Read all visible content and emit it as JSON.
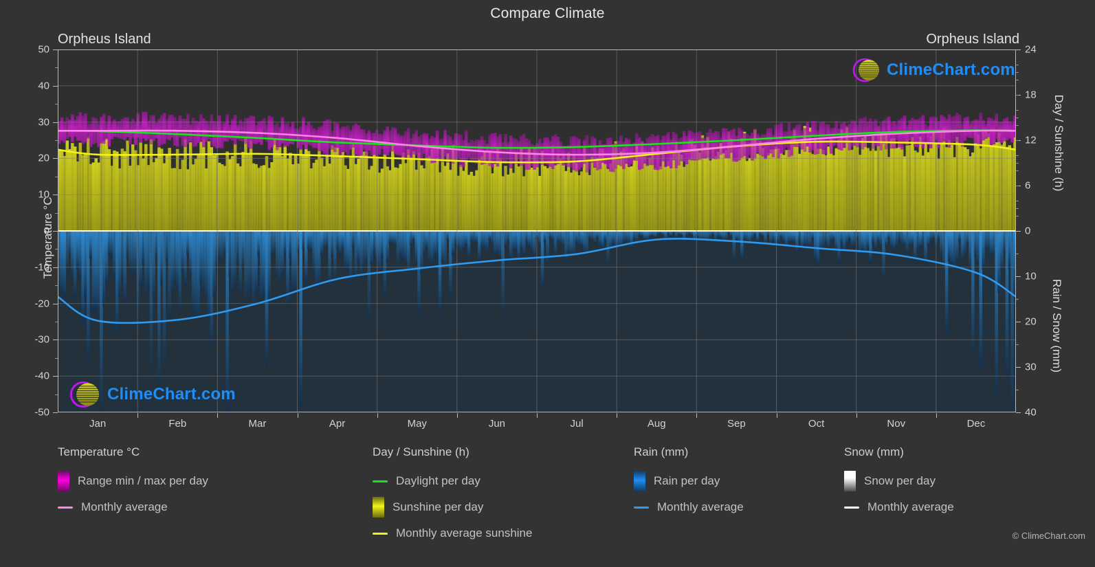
{
  "header": {
    "title": "Compare Climate",
    "location_left": "Orpheus Island",
    "location_right": "Orpheus Island"
  },
  "axes": {
    "left_title": "Temperature °C",
    "right_title_top": "Day / Sunshine (h)",
    "right_title_bottom": "Rain / Snow (mm)",
    "temp_ticks": [
      "50",
      "40",
      "30",
      "20",
      "10",
      "0",
      "-10",
      "-20",
      "-30",
      "-40",
      "-50"
    ],
    "sun_ticks": [
      "24",
      "18",
      "12",
      "6",
      "0"
    ],
    "rain_ticks": [
      "0",
      "10",
      "20",
      "30",
      "40"
    ],
    "months": [
      "Jan",
      "Feb",
      "Mar",
      "Apr",
      "May",
      "Jun",
      "Jul",
      "Aug",
      "Sep",
      "Oct",
      "Nov",
      "Dec"
    ]
  },
  "legend": {
    "groups": [
      {
        "title": "Temperature °C",
        "items": [
          {
            "label": "Range min / max per day",
            "swatch": "gradient",
            "color": "#ff00e6",
            "color2": "#6d0a63"
          },
          {
            "label": "Monthly average",
            "swatch": "line",
            "color": "#ff84e8"
          }
        ]
      },
      {
        "title": "Day / Sunshine (h)",
        "items": [
          {
            "label": "Daylight per day",
            "swatch": "line",
            "color": "#19e619"
          },
          {
            "label": "Sunshine per day",
            "swatch": "gradient",
            "color": "#f2f21a",
            "color2": "#6b6b10"
          },
          {
            "label": "Monthly average sunshine",
            "swatch": "line",
            "color": "#f2f21a"
          }
        ]
      },
      {
        "title": "Rain (mm)",
        "items": [
          {
            "label": "Rain per day",
            "swatch": "gradient",
            "color": "#1f8df5",
            "color2": "#123a60"
          },
          {
            "label": "Monthly average",
            "swatch": "line",
            "color": "#2f9bf0"
          }
        ]
      },
      {
        "title": "Snow (mm)",
        "items": [
          {
            "label": "Snow per day",
            "swatch": "gradient",
            "color": "#ffffff",
            "color2": "#5a5a5a"
          },
          {
            "label": "Monthly average",
            "swatch": "line",
            "color": "#ffffff"
          }
        ]
      }
    ]
  },
  "watermark": {
    "text": "ClimeChart.com",
    "copyright": "© ClimeChart.com"
  },
  "colors": {
    "background": "#333333",
    "plot_background": "#2f2f2f",
    "grid": "#7d7d7d",
    "axis": "#b9b9b9",
    "text": "#d2d2d2",
    "temp_range": "#c016c0",
    "temp_avg": "#ff84e8",
    "daylight": "#19e619",
    "sunshine": "#f2f21a",
    "rain": "#1f8df5",
    "snow": "#ffffff",
    "watermark_text": "#1f8df5",
    "watermark_arc": "#c016f0"
  },
  "chart_data": {
    "type": "line",
    "title": "Compare Climate",
    "subtitle": "Orpheus Island",
    "xlabel": "",
    "ylabel": "Temperature °C",
    "grid": true,
    "legend_position": "bottom",
    "x": [
      "Jan",
      "Feb",
      "Mar",
      "Apr",
      "May",
      "Jun",
      "Jul",
      "Aug",
      "Sep",
      "Oct",
      "Nov",
      "Dec"
    ],
    "temperature_ylim": [
      -50,
      50
    ],
    "sunshine_ylim": [
      0,
      24
    ],
    "rain_ylim": [
      0,
      40
    ],
    "series": [
      {
        "name": "Monthly average",
        "unit": "°C",
        "axis": "temperature",
        "color": "#ff84e8",
        "values": [
          27.6,
          27.6,
          27.0,
          25.6,
          23.4,
          21.7,
          21.0,
          21.6,
          23.4,
          25.4,
          26.8,
          27.6
        ]
      },
      {
        "name": "Range max per day",
        "unit": "°C",
        "axis": "temperature",
        "color": "#c016c0",
        "values": [
          31.0,
          31.0,
          30.3,
          29.0,
          27.0,
          25.3,
          24.8,
          25.3,
          27.0,
          28.8,
          30.0,
          30.8
        ]
      },
      {
        "name": "Range min per day",
        "unit": "°C",
        "axis": "temperature",
        "color": "#c016c0",
        "values": [
          24.6,
          24.7,
          24.0,
          22.5,
          20.2,
          18.5,
          17.6,
          18.2,
          20.2,
          22.4,
          23.9,
          24.6
        ]
      },
      {
        "name": "Daylight per day",
        "unit": "h",
        "axis": "sunshine",
        "color": "#19e619",
        "values": [
          13.2,
          12.8,
          12.3,
          11.7,
          11.3,
          11.0,
          11.1,
          11.5,
          12.0,
          12.6,
          13.1,
          13.3
        ]
      },
      {
        "name": "Monthly average sunshine",
        "unit": "h",
        "axis": "sunshine",
        "color": "#f2f21a",
        "values": [
          10.1,
          10.1,
          10.2,
          9.9,
          9.5,
          9.1,
          9.2,
          10.2,
          11.2,
          11.8,
          11.7,
          11.4
        ]
      },
      {
        "name": "Rain monthly average",
        "unit": "mm",
        "axis": "rain",
        "color": "#2f9bf0",
        "values": [
          19.8,
          19.6,
          16.0,
          10.6,
          8.3,
          6.5,
          5.1,
          1.9,
          2.3,
          3.8,
          5.3,
          9.2
        ]
      },
      {
        "name": "Snow monthly average",
        "unit": "mm",
        "axis": "rain",
        "color": "#ffffff",
        "values": [
          0,
          0,
          0,
          0,
          0,
          0,
          0,
          0,
          0,
          0,
          0,
          0
        ]
      }
    ]
  }
}
